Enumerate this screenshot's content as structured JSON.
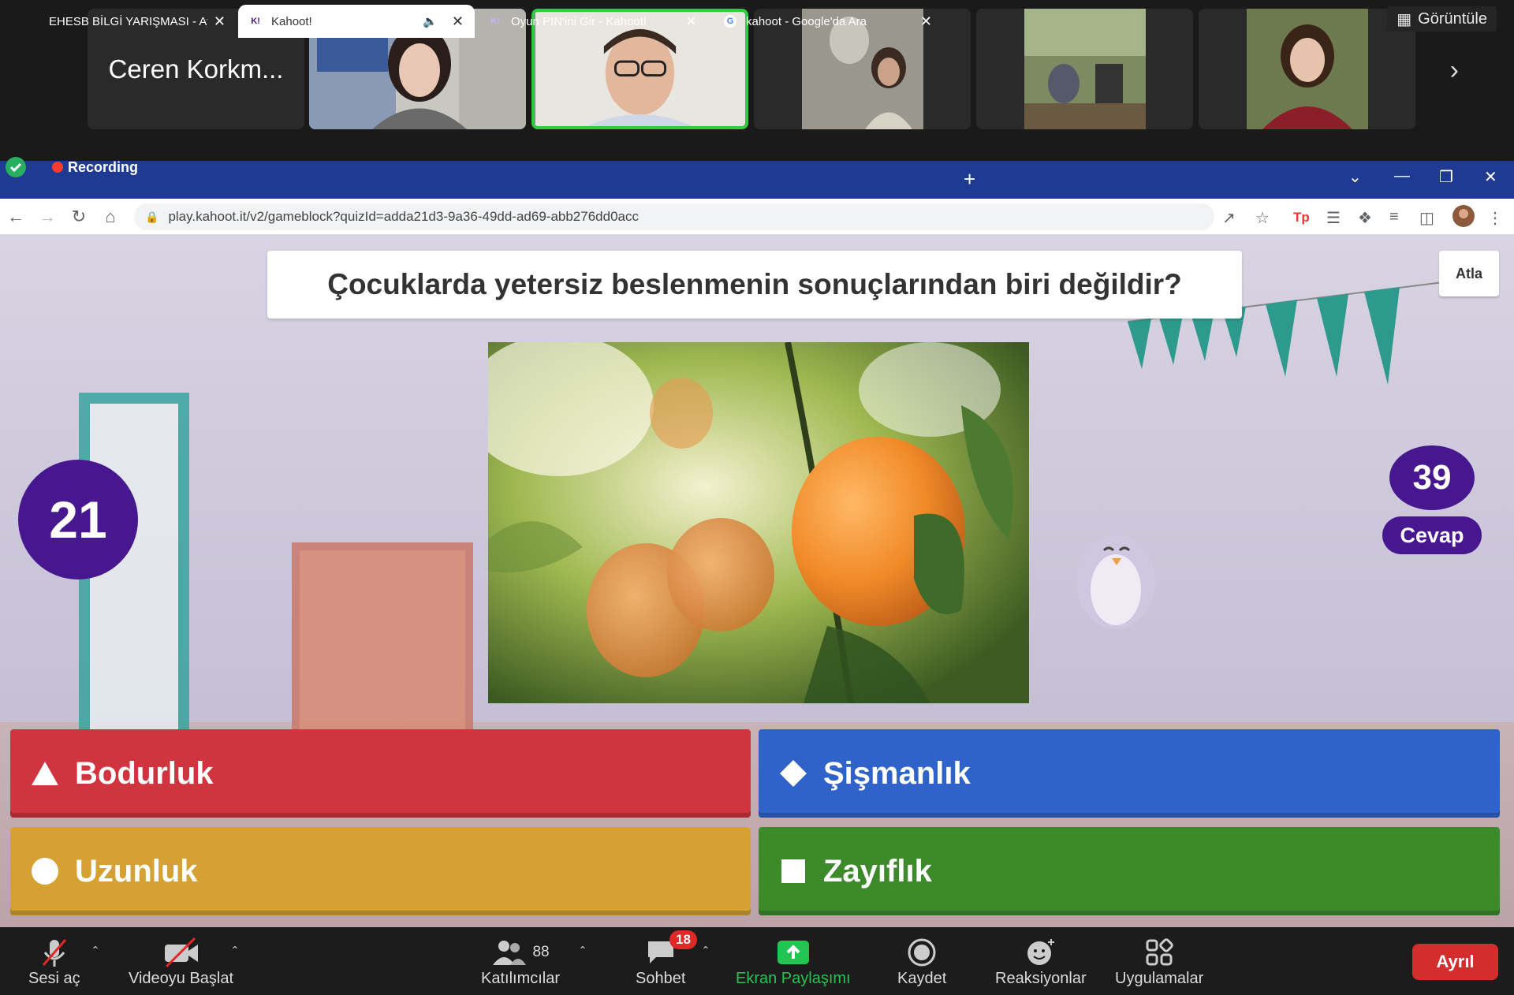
{
  "zoom": {
    "participants": [
      {
        "name": "Ceren Korkm...",
        "type": "name"
      },
      {
        "name": "",
        "type": "video"
      },
      {
        "name": "",
        "type": "video-active"
      },
      {
        "name": "",
        "type": "photo"
      },
      {
        "name": "",
        "type": "photo"
      },
      {
        "name": "",
        "type": "photo"
      }
    ],
    "view_label": "Görüntüle",
    "recording_label": "Recording"
  },
  "browser": {
    "tabs": [
      {
        "label": "EHESB BİLGİ YARIŞMASI - Ayrıntıl"
      },
      {
        "label": "Kahoot!",
        "icon_text": "K!"
      },
      {
        "label": "Oyun PIN'ini Gir - Kahoot!",
        "icon_text": "K!"
      },
      {
        "label": "kahoot - Google'da Ara",
        "icon_text": "G"
      }
    ],
    "url": "play.kahoot.it/v2/gameblock?quizId=adda21d3-9a36-49dd-ad69-abb276dd0acc"
  },
  "game": {
    "question": "Çocuklarda yetersiz beslenmenin sonuçlarından biri değildir?",
    "skip_label": "Atla",
    "timer": "21",
    "answers_count": "39",
    "answers_label": "Cevap",
    "answers": [
      {
        "text": "Bodurluk",
        "shape": "triangle",
        "color": "#d0343e"
      },
      {
        "text": "Şişmanlık",
        "shape": "diamond",
        "color": "#2f63c9"
      },
      {
        "text": "Uzunluk",
        "shape": "circle",
        "color": "#d4a132"
      },
      {
        "text": "Zayıflık",
        "shape": "square",
        "color": "#3d8a2b"
      }
    ]
  },
  "toolbar": {
    "mute_label": "Sesi aç",
    "video_label": "Videoyu Başlat",
    "participants_count": "88",
    "participants_label": "Katılımcılar",
    "chat_label": "Sohbet",
    "chat_badge": "18",
    "share_label": "Ekran Paylaşımı",
    "record_label": "Kaydet",
    "reactions_label": "Reaksiyonlar",
    "apps_label": "Uygulamalar",
    "leave_label": "Ayrıl"
  }
}
